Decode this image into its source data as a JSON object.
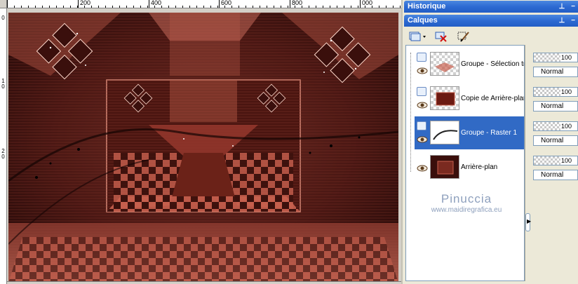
{
  "rulers": {
    "top_labels": [
      "200",
      "400",
      "600",
      "800",
      "000"
    ],
    "left_labels": [
      "0",
      "1",
      "0",
      "2",
      "0"
    ]
  },
  "panels": {
    "historique": {
      "title": "Historique"
    },
    "calques": {
      "title": "Calques"
    }
  },
  "toolbar": {
    "icons": [
      "new-layer-icon",
      "delete-layer-icon",
      "edit-brush-icon"
    ]
  },
  "layers": [
    {
      "name": "Groupe - Sélection tra",
      "opacity": "100",
      "blend": "Normal",
      "selected": false,
      "opacity_fraction": 1.0
    },
    {
      "name": "Copie de Arrière-plan",
      "opacity": "100",
      "blend": "Normal",
      "selected": false,
      "opacity_fraction": 1.0
    },
    {
      "name": "Groupe - Raster 1",
      "opacity": "100",
      "blend": "Normal",
      "selected": true,
      "opacity_fraction": 1.0
    },
    {
      "name": "Arrière-plan",
      "opacity": "100",
      "blend": "Normal",
      "selected": false,
      "opacity_fraction": 1.0
    }
  ],
  "watermark": {
    "name": "Pinuccia",
    "url": "www.maidiregrafica.eu"
  },
  "colors": {
    "titlebar": "#2d6ad2",
    "selection": "#316ac5",
    "artwork_base": "#3a0f0c",
    "artwork_accent": "#c8604e"
  }
}
